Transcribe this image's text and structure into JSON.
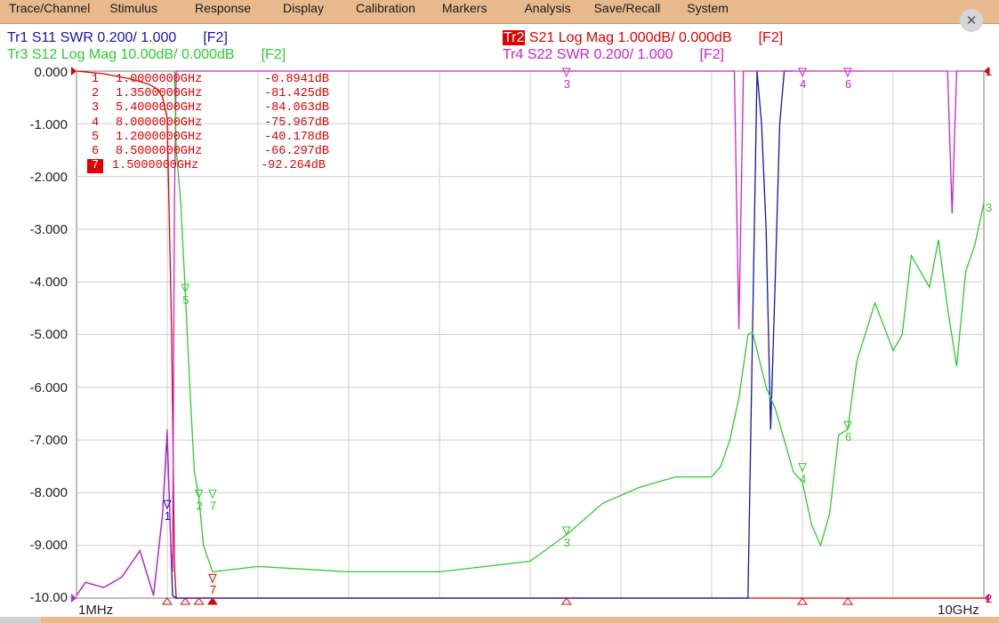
{
  "menu": [
    "Trace/Channel",
    "Stimulus",
    "Response",
    "Display",
    "Calibration",
    "Markers",
    "Analysis",
    "Save/Recall",
    "System"
  ],
  "close_icon": "close-icon",
  "traces": {
    "tr1": {
      "label": "Tr1",
      "text": " S11 SWR 0.200/ 1.000",
      "fkey": "[F2]",
      "color": "#1414b4"
    },
    "tr2": {
      "label": "Tr2",
      "text": " S21 Log Mag 1.000dB/ 0.000dB",
      "fkey": "[F2]",
      "color": "#e00000"
    },
    "tr3": {
      "label": "Tr3",
      "text": " S12 Log Mag 10.00dB/ 0.000dB",
      "fkey": "[F2]",
      "color": "#2ecc2e"
    },
    "tr4": {
      "label": "Tr4",
      "text": " S22 SWR 0.200/ 1.000",
      "fkey": "[F2]",
      "color": "#cc22cc"
    }
  },
  "markers": [
    {
      "n": "1",
      "freq": "1.0000000GHz",
      "value": "-0.8941dB",
      "active": false
    },
    {
      "n": "2",
      "freq": "1.3500000GHz",
      "value": "-81.425dB",
      "active": false
    },
    {
      "n": "3",
      "freq": "5.4000000GHz",
      "value": "-84.063dB",
      "active": false
    },
    {
      "n": "4",
      "freq": "8.0000000GHz",
      "value": "-75.967dB",
      "active": false
    },
    {
      "n": "5",
      "freq": "1.2000000GHz",
      "value": "-40.178dB",
      "active": false
    },
    {
      "n": "6",
      "freq": "8.5000000GHz",
      "value": "-66.297dB",
      "active": false
    },
    {
      "n": "7",
      "freq": "1.5000000GHz",
      "value": "-92.264dB",
      "active": true
    }
  ],
  "chart_data": {
    "type": "line",
    "xlim": [
      0.001,
      10
    ],
    "x_scale": "linear",
    "x_tick_labels": {
      "start": "1MHz",
      "stop": "10GHz"
    },
    "x_divisions": 10,
    "ylim": [
      -10,
      0
    ],
    "y_ticks": [
      "0.000",
      "-1.000",
      "-2.000",
      "-3.000",
      "-4.000",
      "-5.000",
      "-6.000",
      "-7.000",
      "-8.000",
      "-9.000",
      "-10.00"
    ],
    "grid": true,
    "series": [
      {
        "name": "Tr1",
        "color": "#1414b4",
        "x": [
          0.001,
          0.1,
          0.3,
          0.5,
          0.7,
          0.85,
          0.95,
          1.0,
          1.02,
          1.04,
          1.06,
          1.1,
          1.2,
          7.3,
          7.4,
          7.5,
          7.55,
          7.6,
          7.65,
          7.7,
          7.75,
          7.8,
          7.9
        ],
        "y": [
          -9.95,
          -9.7,
          -9.8,
          -9.6,
          -9.1,
          -9.95,
          -8.4,
          -6.9,
          -7.9,
          -9.0,
          -9.95,
          -10,
          -10,
          -10,
          -10,
          0,
          -1,
          -3,
          -6.8,
          -4,
          -1,
          0,
          0
        ]
      },
      {
        "name": "Tr2",
        "color": "#e00000",
        "x": [
          0.001,
          0.3,
          0.6,
          0.8,
          0.9,
          0.95,
          1.0,
          1.05,
          1.08,
          1.1,
          10
        ],
        "y": [
          0,
          -0.05,
          -0.15,
          -0.25,
          -0.35,
          -0.5,
          -0.9,
          -5.0,
          -9.4,
          -10,
          -10
        ]
      },
      {
        "name": "Tr3",
        "color": "#2ecc2e",
        "x": [
          1.08,
          1.1,
          1.15,
          1.2,
          1.25,
          1.3,
          1.35,
          1.4,
          1.5,
          2.0,
          3.0,
          4.0,
          5.0,
          5.4,
          5.8,
          6.2,
          6.6,
          7.0,
          7.1,
          7.2,
          7.3,
          7.35,
          7.4,
          7.45,
          7.5,
          7.6,
          7.7,
          7.8,
          7.9,
          8.0,
          8.1,
          8.2,
          8.3,
          8.4,
          8.5,
          8.6,
          8.8,
          9.0,
          9.1,
          9.2,
          9.4,
          9.5,
          9.6,
          9.7,
          9.8,
          9.9,
          10.0
        ],
        "y": [
          0,
          -1.5,
          -2.5,
          -4.2,
          -6.0,
          -7.6,
          -8.1,
          -9.0,
          -9.5,
          -9.4,
          -9.5,
          -9.5,
          -9.3,
          -8.8,
          -8.2,
          -7.9,
          -7.7,
          -7.7,
          -7.5,
          -7.0,
          -6.2,
          -5.6,
          -5.0,
          -4.95,
          -5.3,
          -6.0,
          -6.4,
          -7.0,
          -7.6,
          -7.8,
          -8.6,
          -9.0,
          -8.4,
          -6.9,
          -6.8,
          -5.5,
          -4.4,
          -5.3,
          -5.0,
          -3.5,
          -4.1,
          -3.2,
          -4.5,
          -5.6,
          -3.8,
          -3.3,
          -2.5
        ]
      },
      {
        "name": "Tr4",
        "color": "#cc22cc",
        "x": [
          0.001,
          0.1,
          0.3,
          0.5,
          0.7,
          0.85,
          0.95,
          1.0,
          1.02,
          1.04,
          1.06,
          1.08,
          1.1,
          7.25,
          7.3,
          7.35,
          7.4,
          9.6,
          9.65,
          9.7,
          10
        ],
        "y": [
          -9.95,
          -9.7,
          -9.8,
          -9.6,
          -9.1,
          -9.95,
          -8.4,
          -6.8,
          -7.9,
          -9.0,
          -9.5,
          -2.5,
          0,
          0,
          -4.9,
          0,
          0,
          0,
          -2.7,
          0,
          0
        ]
      }
    ],
    "trace_markers": [
      {
        "trace": "Tr3",
        "n": "5",
        "x": 1.2,
        "y": -4.2
      },
      {
        "trace": "Tr3",
        "n": "2",
        "x": 1.35,
        "y": -8.1
      },
      {
        "trace": "Tr3",
        "n": "7",
        "x": 1.5,
        "y": -8.1
      },
      {
        "trace": "Tr3",
        "n": "3",
        "x": 5.4,
        "y": -8.8
      },
      {
        "trace": "Tr3",
        "n": "4",
        "x": 8.0,
        "y": -7.6
      },
      {
        "trace": "Tr3",
        "n": "6",
        "x": 8.5,
        "y": -6.8
      },
      {
        "trace": "Tr2",
        "n": "7",
        "x": 1.5,
        "y": -9.7
      },
      {
        "trace": "Tr1",
        "n": "1",
        "x": 1.0,
        "y": -8.3
      },
      {
        "trace": "Tr4",
        "n": "3",
        "x": 5.4,
        "y": -0.1
      },
      {
        "trace": "Tr4",
        "n": "4",
        "x": 8.0,
        "y": -0.1
      },
      {
        "trace": "Tr4",
        "n": "6",
        "x": 8.5,
        "y": -0.1
      }
    ],
    "end_labels": {
      "tr3": "3",
      "right_top": "1",
      "right_bottom": "2"
    }
  }
}
